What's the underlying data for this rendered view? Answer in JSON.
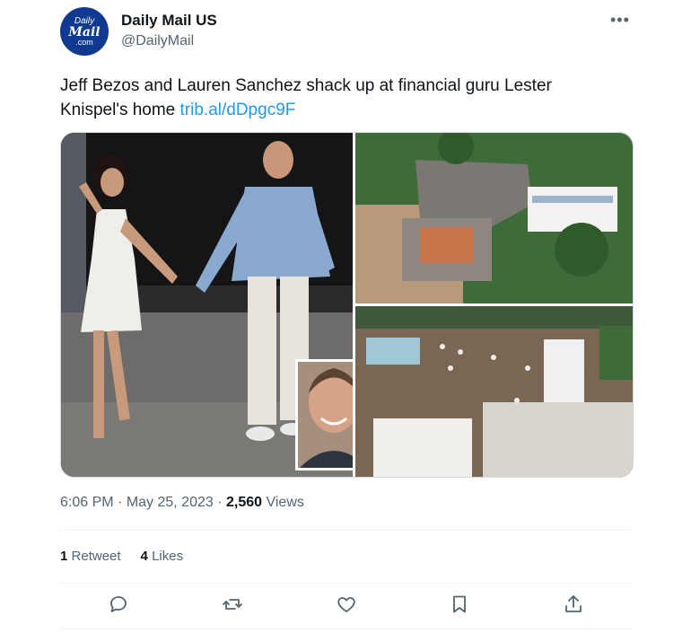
{
  "account": {
    "avatar_lines": [
      "Daily",
      "Mail",
      ".com"
    ],
    "display_name": "Daily Mail US",
    "handle": "@DailyMail"
  },
  "tweet": {
    "text": "Jeff Bezos and Lauren Sanchez shack up at financial guru Lester Knispel's home ",
    "link_text": "trib.al/dDpgc9F"
  },
  "meta": {
    "time": "6:06 PM",
    "dot": " · ",
    "date": "May 25, 2023",
    "views_count": "2,560",
    "views_label": "Views"
  },
  "stats": {
    "retweets_count": "1",
    "retweets_label": "Retweet",
    "likes_count": "4",
    "likes_label": "Likes"
  },
  "icons": [
    "more-icon",
    "reply-icon",
    "retweet-icon",
    "like-icon",
    "bookmark-icon",
    "share-icon"
  ],
  "colors": {
    "link": "#1d9bf0",
    "muted": "#536471",
    "text": "#0f1419",
    "avatar_bg": "#0f3a8f"
  }
}
